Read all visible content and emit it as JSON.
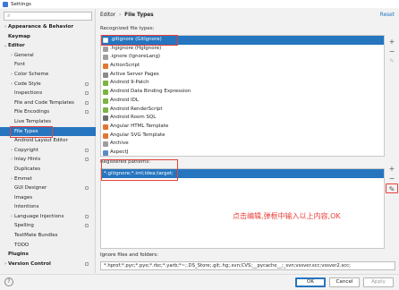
{
  "window": {
    "title": "Settings"
  },
  "search": {
    "icon": "search-icon",
    "value": ""
  },
  "sidebar": {
    "items": [
      {
        "label": "Appearance & Behavior",
        "bold": true,
        "arrow": "›",
        "level": 0
      },
      {
        "label": "Keymap",
        "bold": true,
        "arrow": "",
        "level": 0
      },
      {
        "label": "Editor",
        "bold": true,
        "arrow": "⌄",
        "level": 0
      },
      {
        "label": "General",
        "arrow": "›",
        "level": 1
      },
      {
        "label": "Font",
        "arrow": "",
        "level": 1
      },
      {
        "label": "Color Scheme",
        "arrow": "›",
        "level": 1
      },
      {
        "label": "Code Style",
        "arrow": "›",
        "level": 1,
        "cfg": true
      },
      {
        "label": "Inspections",
        "arrow": "",
        "level": 1,
        "cfg": true
      },
      {
        "label": "File and Code Templates",
        "arrow": "",
        "level": 1,
        "cfg": true
      },
      {
        "label": "File Encodings",
        "arrow": "",
        "level": 1,
        "cfg": true
      },
      {
        "label": "Live Templates",
        "arrow": "",
        "level": 1
      },
      {
        "label": "File Types",
        "arrow": "",
        "level": 1,
        "selected": true
      },
      {
        "label": "Android Layout Editor",
        "arrow": "",
        "level": 1
      },
      {
        "label": "Copyright",
        "arrow": "›",
        "level": 1,
        "cfg": true
      },
      {
        "label": "Inlay Hints",
        "arrow": "›",
        "level": 1,
        "cfg": true
      },
      {
        "label": "Duplicates",
        "arrow": "",
        "level": 1
      },
      {
        "label": "Emmet",
        "arrow": "›",
        "level": 1
      },
      {
        "label": "GUI Designer",
        "arrow": "",
        "level": 1,
        "cfg": true
      },
      {
        "label": "Images",
        "arrow": "",
        "level": 1
      },
      {
        "label": "Intentions",
        "arrow": "",
        "level": 1
      },
      {
        "label": "Language Injections",
        "arrow": "›",
        "level": 1,
        "cfg": true
      },
      {
        "label": "Spelling",
        "arrow": "",
        "level": 1,
        "cfg": true
      },
      {
        "label": "TextMate Bundles",
        "arrow": "",
        "level": 1
      },
      {
        "label": "TODO",
        "arrow": "",
        "level": 1
      },
      {
        "label": "Plugins",
        "bold": true,
        "arrow": "",
        "level": 0
      },
      {
        "label": "Version Control",
        "bold": true,
        "arrow": "›",
        "level": 0,
        "cfg": true
      }
    ]
  },
  "header": {
    "breadcrumb_parent": "Editor",
    "breadcrumb_sep": "›",
    "breadcrumb_current": "File Types",
    "reset_label": "Reset"
  },
  "recognized": {
    "label": "Recognized file types:",
    "items": [
      {
        "label": ".gitignore (GitIgnore)",
        "color": "#ffffff",
        "selected": true
      },
      {
        "label": ".hgignore (HgIgnore)",
        "color": "#9e9e9e"
      },
      {
        "label": ".ignore (IgnoreLang)",
        "color": "#9e9e9e"
      },
      {
        "label": "ActionScript",
        "color": "#e0762f"
      },
      {
        "label": "Active Server Pages",
        "color": "#8a8a8a"
      },
      {
        "label": "Android 9-Patch",
        "color": "#7cb342"
      },
      {
        "label": "Android Data Binding Expression",
        "color": "#7cb342"
      },
      {
        "label": "Android IDL",
        "color": "#7cb342"
      },
      {
        "label": "Android RenderScript",
        "color": "#7cb342"
      },
      {
        "label": "Android Room SQL",
        "color": "#6d6d6d"
      },
      {
        "label": "Angular HTML Template",
        "color": "#e0762f"
      },
      {
        "label": "Angular SVG Template",
        "color": "#e0762f"
      },
      {
        "label": "Archive",
        "color": "#9e9e9e"
      },
      {
        "label": "AspectJ",
        "color": "#5b8ac7"
      }
    ]
  },
  "patterns": {
    "label": "Registered patterns:",
    "items": [
      "*.gitignore;*.iml;idea;target;"
    ]
  },
  "annotation": "点击编辑,弹框中输入以上内容,OK",
  "ignore": {
    "label": "Ignore files and folders:",
    "value": "*.hprof;*.pyc;*.pyo;*.rbc;*.yarb;*~;.DS_Store;.git;.hg;.svn;CVS;__pycache__;_svn;vssver.scc;vssver2.scc;"
  },
  "buttons": {
    "add": "+",
    "remove": "−",
    "edit": "✎",
    "ok": "OK",
    "cancel": "Cancel",
    "apply": "Apply",
    "help": "?"
  }
}
